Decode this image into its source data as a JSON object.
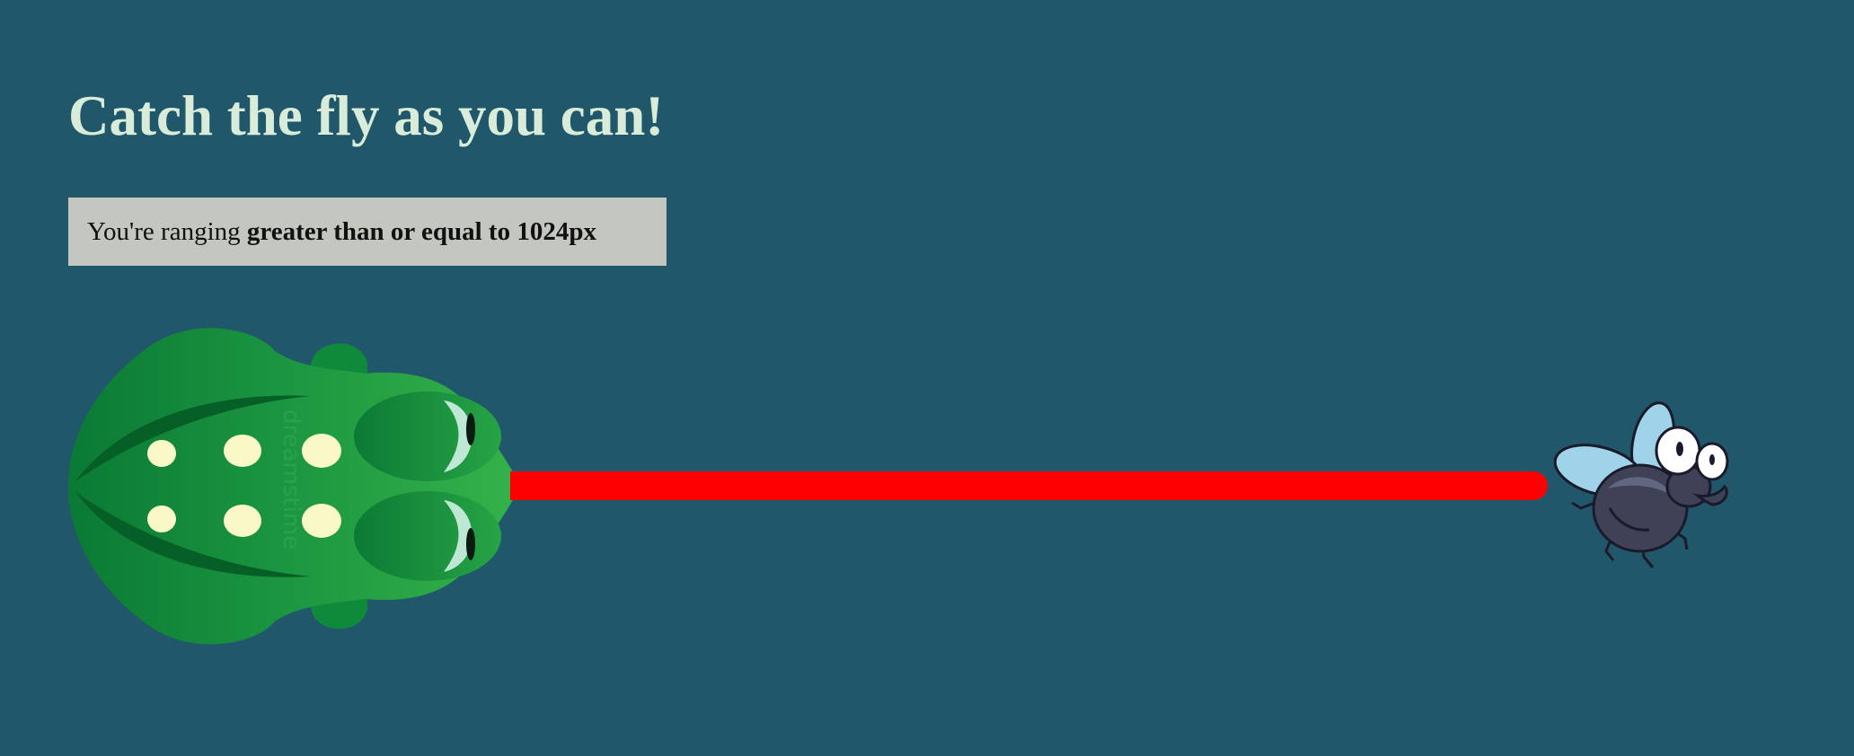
{
  "page": {
    "title": "Catch the fly as you can!",
    "range_prefix": "You're ranging ",
    "range_value": "greater than or equal to 1024px"
  },
  "colors": {
    "background": "#20576a",
    "title": "#d9ecd9",
    "range_box": "#c3c7c0",
    "tongue": "#ff0000",
    "frog": "#1f9a3f",
    "fly_body": "#3f4257",
    "fly_wing": "#9fd3ea"
  },
  "images": {
    "frog": "frog-icon",
    "fly": "fly-icon",
    "watermark": "dreamstime"
  }
}
